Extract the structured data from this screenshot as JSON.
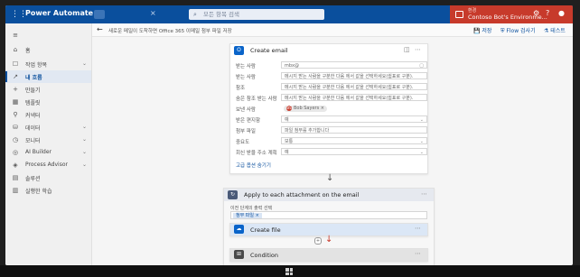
{
  "topbar": {
    "app_title": "Power Automate",
    "search_placeholder": "모든 항목 검색",
    "environment_label": "환경",
    "environment_name": "Contoso Bot's Environme..."
  },
  "sidebar": {
    "items": [
      {
        "icon": "menu-icon",
        "glyph": "≡",
        "label": "",
        "chevron": false
      },
      {
        "icon": "home-icon",
        "glyph": "⌂",
        "label": "홈",
        "chevron": false
      },
      {
        "icon": "action-items-icon",
        "glyph": "☐",
        "label": "작업 항목",
        "chevron": true
      },
      {
        "icon": "my-flows-icon",
        "glyph": "↗",
        "label": "내 흐름",
        "chevron": false,
        "active": true
      },
      {
        "icon": "create-icon",
        "glyph": "+",
        "label": "만들기",
        "chevron": false
      },
      {
        "icon": "templates-icon",
        "glyph": "▦",
        "label": "템플릿",
        "chevron": false
      },
      {
        "icon": "connectors-icon",
        "glyph": "⚲",
        "label": "커넥터",
        "chevron": false
      },
      {
        "icon": "data-icon",
        "glyph": "⛁",
        "label": "데이터",
        "chevron": true
      },
      {
        "icon": "monitor-icon",
        "glyph": "◷",
        "label": "모니터",
        "chevron": true
      },
      {
        "icon": "ai-builder-icon",
        "glyph": "◎",
        "label": "AI Builder",
        "chevron": true
      },
      {
        "icon": "process-advisor-icon",
        "glyph": "◈",
        "label": "Process Advisor",
        "chevron": true
      },
      {
        "icon": "solutions-icon",
        "glyph": "▤",
        "label": "솔루션",
        "chevron": false
      },
      {
        "icon": "learn-icon",
        "glyph": "▥",
        "label": "실행한 학습",
        "chevron": false
      }
    ]
  },
  "cmdbar": {
    "breadcrumb": "새로운 메일이 도착하면 Office 365 이메일 첨부 파일 저장",
    "save_label": "저장",
    "flow_checker_label": "Flow 검사기",
    "test_label": "테스트"
  },
  "cards": {
    "email": {
      "title": "Create email",
      "badge": "O",
      "fields": [
        {
          "label": "받는 사람",
          "value": "mbx@",
          "dropdown": false
        },
        {
          "label": "받는 사람",
          "value": "메시지 받는 사람을 구분한 다음 에서 값을 선택하세요(쉼표로 구분).",
          "dropdown": false
        },
        {
          "label": "참조",
          "value": "메시지 받는 사람을 구분한 다음 에서 값을 선택하세요(쉼표로 구분).",
          "dropdown": false
        },
        {
          "label": "숨은 참조 받는 사람",
          "value": "메시지 받는 사람을 구분한 다음 에서 값을 선택하세요(쉼표로 구분).",
          "dropdown": false
        },
        {
          "label": "보낸 사람",
          "value": "Bob Sayers",
          "chip": true,
          "chip_initials": "BS",
          "dropdown": false
        },
        {
          "label": "받은 편지함",
          "value": "예",
          "dropdown": true
        },
        {
          "label": "첨부 파일",
          "value": "파일 첨부를 추가합니다",
          "dropdown": false
        },
        {
          "label": "중요도",
          "value": "보통",
          "dropdown": true
        },
        {
          "label": "회신 받을 주소 계획",
          "value": "예",
          "dropdown": true
        }
      ],
      "advanced_label": "고급 옵션 숨기기"
    },
    "apply": {
      "title": "Apply to each attachment on the email",
      "badge": "↻",
      "select_label": "이전 단계의 출력 선택",
      "token_label": "첨부 파일 ×"
    },
    "create_file": {
      "title": "Create file",
      "badge": "☁"
    },
    "condition": {
      "title": "Condition",
      "badge": "⊞"
    }
  }
}
